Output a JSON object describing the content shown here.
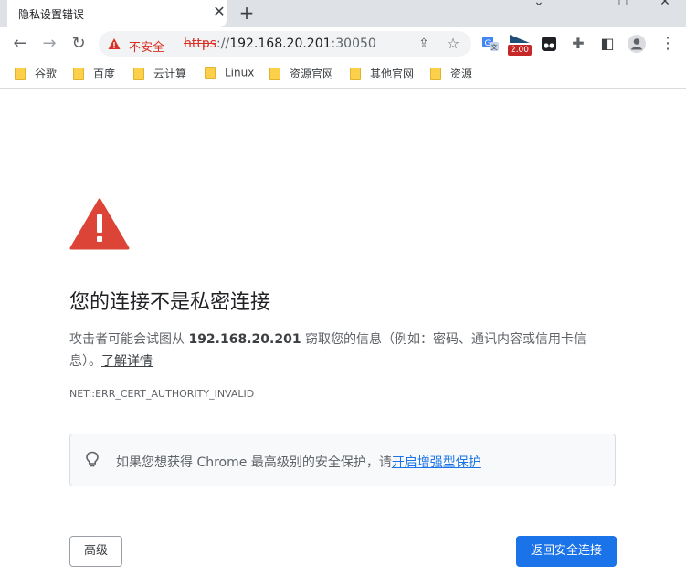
{
  "tab": {
    "title": "隐私设置错误",
    "close_glyph": "✕",
    "new_tab_glyph": "+"
  },
  "window": {
    "minimize_glyph": "⌄",
    "restore_glyph": "☐",
    "close_glyph": "✕"
  },
  "toolbar": {
    "back_glyph": "←",
    "forward_glyph": "→",
    "reload_glyph": "↻",
    "security_label": "不安全",
    "url_scheme": "https",
    "url_rest_prefix": "://",
    "url_host": "192.168.20.201",
    "url_port": ":30050",
    "share_glyph": "⇪",
    "star_glyph": "☆"
  },
  "extensions": {
    "badge_value": "2.00",
    "puzzle_glyph": "✚",
    "sidepanel_glyph": "◧",
    "menu_glyph": "⋮"
  },
  "bookmarks": [
    {
      "label": "谷歌"
    },
    {
      "label": "百度"
    },
    {
      "label": "云计算"
    },
    {
      "label": "Linux"
    },
    {
      "label": "资源官网"
    },
    {
      "label": "其他官网"
    },
    {
      "label": "资源"
    }
  ],
  "page": {
    "heading": "您的连接不是私密连接",
    "para_prefix": "攻击者可能会试图从 ",
    "para_host": "192.168.20.201",
    "para_suffix": " 窃取您的信息（例如：密码、通讯内容或信用卡信息）。",
    "learn_more": "了解详情",
    "error_code": "NET::ERR_CERT_AUTHORITY_INVALID",
    "tip_text": "如果您想获得 Chrome 最高级别的安全保护，请",
    "tip_link": "开启增强型保护",
    "advanced_button": "高级",
    "back_button": "返回安全连接"
  },
  "colors": {
    "danger": "#d93025",
    "primary": "#1a73e8",
    "text": "#202124",
    "secondary_text": "#5f6368",
    "folder": "#fcd04b"
  }
}
